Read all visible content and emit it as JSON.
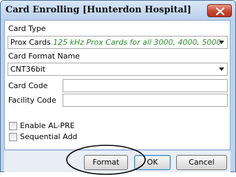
{
  "window": {
    "title": "Card Enrolling [Hunterdon Hospital]"
  },
  "card_type": {
    "label": "Card Type",
    "selected_value": "Prox Cards",
    "selected_description": "125 kHz Prox Cards for all 3000, 4000, 5000"
  },
  "card_format": {
    "label": "Card Format Name",
    "selected_value": "CNT36bit"
  },
  "card_code": {
    "label": "Card Code",
    "value": ""
  },
  "facility_code": {
    "label": "Facility Code",
    "value": ""
  },
  "options": {
    "enable_al_pre": "Enable AL-PRE",
    "sequential_add": "Sequential Add"
  },
  "buttons": {
    "format": "Format",
    "ok": "OK",
    "cancel": "Cancel"
  },
  "icons": {
    "close": "close-icon",
    "dropdown": "chevron-down-icon"
  },
  "colors": {
    "title_bar": "#bcd3ee",
    "close_button": "#c84731",
    "description_text": "#2f8a2f",
    "highlight_ellipse": "#000000"
  }
}
